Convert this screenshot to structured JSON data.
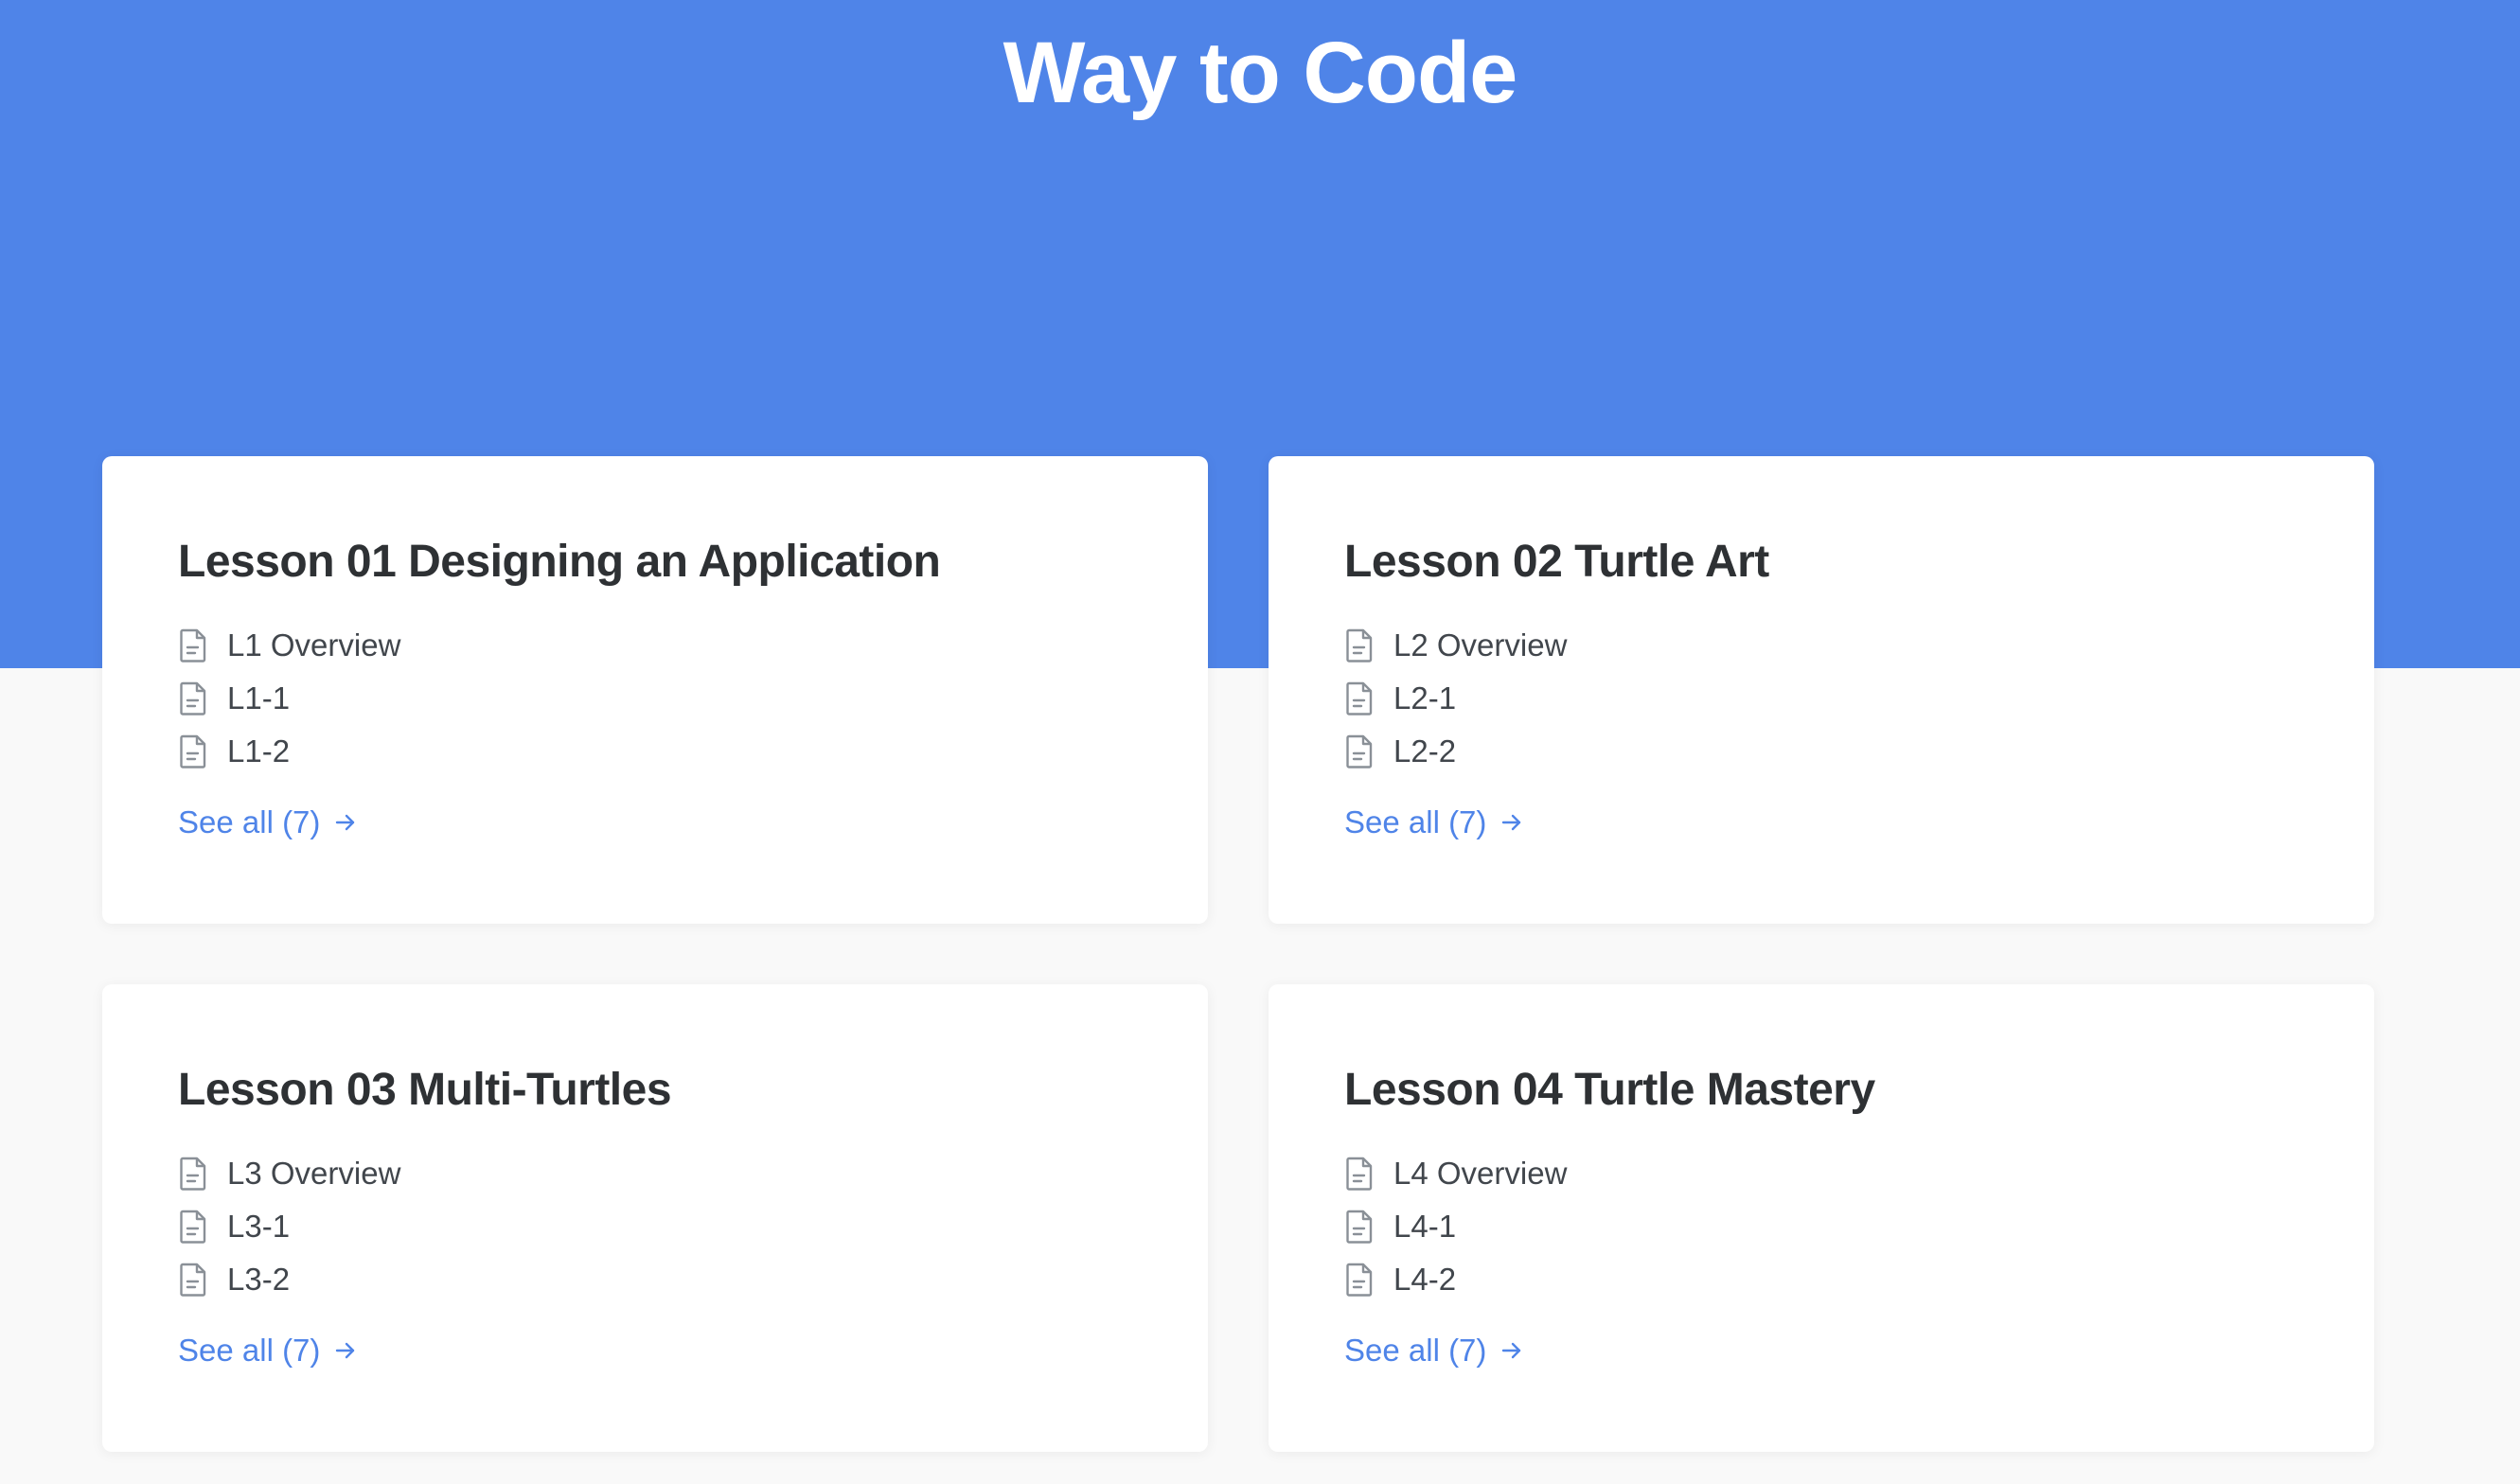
{
  "site": {
    "title": "Way to Code"
  },
  "colors": {
    "hero_background": "#4f84e8",
    "link": "#4f84e8",
    "page_background": "#f9f9f9",
    "card_background": "#ffffff"
  },
  "categories": [
    {
      "title": "Lesson 01 Designing an Application",
      "articles": [
        "L1 Overview",
        "L1-1",
        "L1-2"
      ],
      "see_all": "See all (7)",
      "icon": "document-icon"
    },
    {
      "title": "Lesson 02 Turtle Art",
      "articles": [
        "L2 Overview",
        "L2-1",
        "L2-2"
      ],
      "see_all": "See all (7)",
      "icon": "document-icon"
    },
    {
      "title": "Lesson 03 Multi-Turtles",
      "articles": [
        "L3 Overview",
        "L3-1",
        "L3-2"
      ],
      "see_all": "See all (7)",
      "icon": "document-icon"
    },
    {
      "title": "Lesson 04 Turtle Mastery",
      "articles": [
        "L4 Overview",
        "L4-1",
        "L4-2"
      ],
      "see_all": "See all (7)",
      "icon": "document-icon"
    }
  ]
}
